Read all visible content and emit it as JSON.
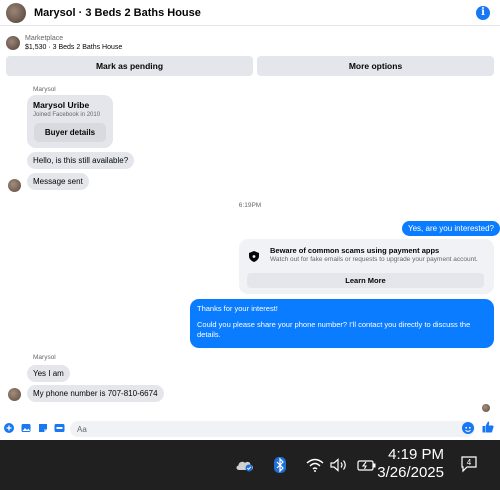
{
  "header": {
    "title": "Marysol · 3 Beds 2 Baths House"
  },
  "listing": {
    "source": "Marketplace",
    "price_title": "$1,530 · 3 Beds 2 Baths House",
    "mark_pending_label": "Mark as pending",
    "more_options_label": "More options"
  },
  "chat": {
    "sender_top": "Marysol",
    "profile": {
      "name": "Marysol Uribe",
      "joined": "Joined Facebook in 2010",
      "button": "Buyer details"
    },
    "msg_available": "Hello, is this still available?",
    "msg_sent": "Message sent",
    "timestamp": "6:19PM",
    "msg_interested": "Yes, are you interested?",
    "scam": {
      "title": "Beware of common scams using payment apps",
      "subtitle": "Watch out for fake emails or requests to upgrade your payment account.",
      "button": "Learn More"
    },
    "msg_long_1": "Thanks for your interest!",
    "msg_long_2": "Could you please share your phone number? I'll contact you directly to discuss the details.",
    "sender_bottom": "Marysol",
    "msg_yes": "Yes I am",
    "msg_phone": "My phone number is 707-810-6674"
  },
  "composer": {
    "placeholder": "Aa"
  },
  "taskbar": {
    "time": "4:19 PM",
    "date": "3/26/2025",
    "notification_count": "4"
  },
  "colors": {
    "accent": "#0a7cff",
    "brand": "#1877f2",
    "taskbar": "#202020"
  }
}
